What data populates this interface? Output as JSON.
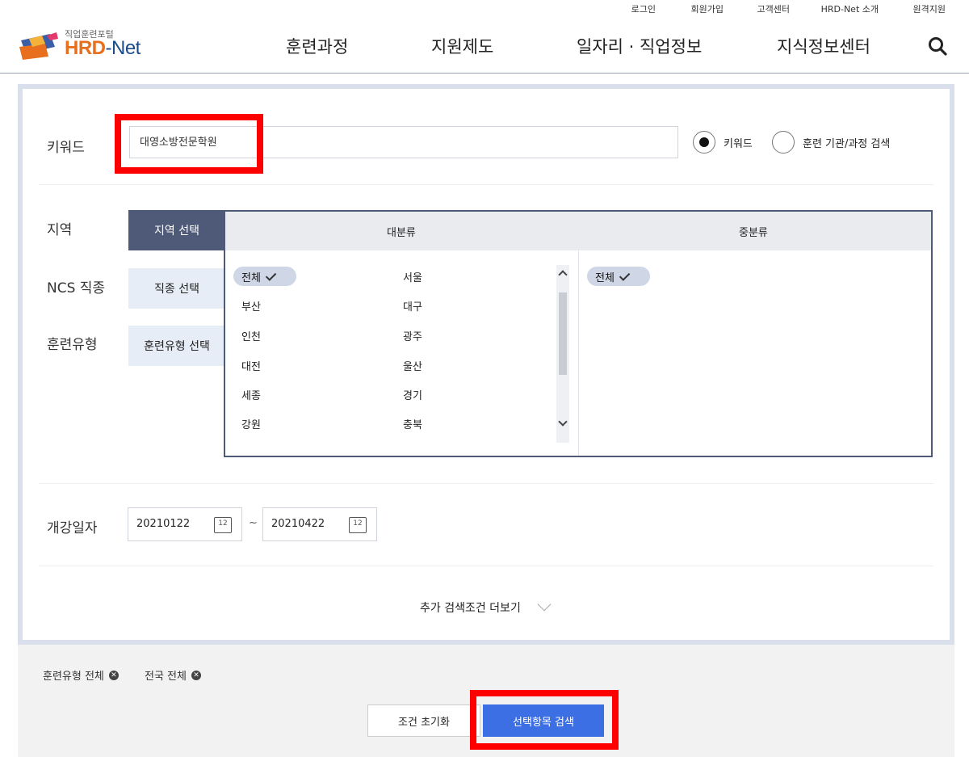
{
  "header": {
    "top_links": [
      "로그인",
      "회원가입",
      "고객센터",
      "HRD-Net 소개",
      "원격지원"
    ],
    "logo_small": "직업훈련포털",
    "logo_brand": "HRD",
    "logo_brand_suffix": "-Net",
    "nav": [
      "훈련과정",
      "지원제도",
      "일자리 · 직업정보",
      "지식정보센터"
    ]
  },
  "search": {
    "keyword_label": "키워드",
    "keyword_value": "대영소방전문학원",
    "radio_options": [
      {
        "label": "키워드",
        "selected": true
      },
      {
        "label": "훈련 기관/과정 검색",
        "selected": false
      }
    ],
    "region_label": "지역",
    "ncs_label": "NCS 직종",
    "training_type_label": "훈련유형",
    "tabs": [
      "지역 선택",
      "직종 선택",
      "훈련유형 선택"
    ],
    "region": {
      "col1_title": "대분류",
      "col2_title": "중분류",
      "col1_items": [
        "전체",
        "서울",
        "부산",
        "대구",
        "인천",
        "광주",
        "대전",
        "울산",
        "세종",
        "경기",
        "강원",
        "충북"
      ],
      "col1_selected": "전체",
      "col2_selected": "전체"
    },
    "date_label": "개강일자",
    "date_from": "20210122",
    "date_to": "20210422",
    "date_sep": "~",
    "calendar_glyph": "12",
    "more_label": "추가 검색조건 더보기"
  },
  "bottom": {
    "tags": [
      "훈련유형 전체",
      "전국 전체"
    ],
    "reset_label": "조건 초기화",
    "search_label": "선택항목 검색"
  },
  "colors": {
    "accent": "#3b6fe3",
    "tab_active": "#4f5a78",
    "highlight": "#ff0000",
    "brand_orange": "#e86f1d"
  }
}
